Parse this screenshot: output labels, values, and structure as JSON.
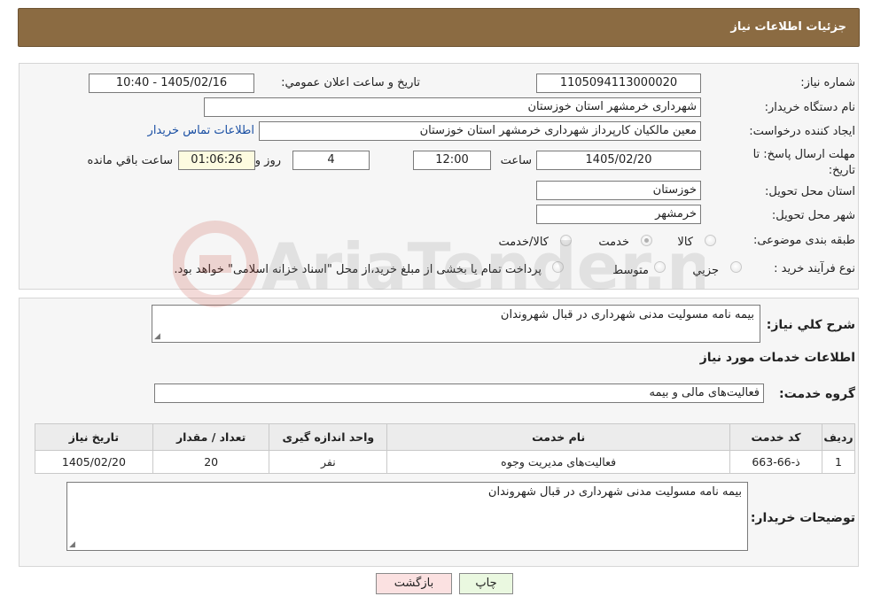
{
  "header": {
    "title": "جزئیات اطلاعات نیاز"
  },
  "form": {
    "need_number_label": "شماره نیاز:",
    "need_number": "1105094113000020",
    "announce_label": "تاریخ و ساعت اعلان عمومي:",
    "announce_value": "1405/02/16 - 10:40",
    "buyer_org_label": "نام دستگاه خریدار:",
    "buyer_org": "شهرداری خرمشهر استان خوزستان",
    "creator_label": "ایجاد کننده درخواست:",
    "creator": "معین مالکیان کارپرداز شهرداری خرمشهر استان خوزستان",
    "contact_link": "اطلاعات تماس خریدار",
    "deadline_label": "مهلت ارسال پاسخ: تا تاریخ:",
    "deadline_date": "1405/02/20",
    "hour_label": "ساعت",
    "deadline_time": "12:00",
    "days": "4",
    "days_label": "روز و",
    "remaining": "01:06:26",
    "remaining_label": "ساعت باقي مانده",
    "province_label": "استان محل تحویل:",
    "province": "خوزستان",
    "city_label": "شهر محل تحویل:",
    "city": "خرمشهر",
    "category_label": "طبقه بندی موضوعی:",
    "category_options": [
      "کالا",
      "خدمت",
      "کالا/خدمت"
    ],
    "process_label": "نوع فرآیند خرید :",
    "process_options": [
      "جزیي",
      "متوسط"
    ],
    "process_note": "پرداخت تمام یا بخشی از مبلغ خرید،از محل \"اسناد خزانه اسلامی\" خواهد بود."
  },
  "details": {
    "description_label": "شرح کلي نیاز:",
    "description": "بیمه نامه مسولیت مدنی شهرداری در قبال شهروندان",
    "services_heading": "اطلاعات خدمات مورد نیاز",
    "service_group_label": "گروه خدمت:",
    "service_group": "فعالیت‌های مالی و بیمه",
    "table": {
      "headers": [
        "ردیف",
        "کد خدمت",
        "نام خدمت",
        "واحد اندازه گیری",
        "تعداد / مقدار",
        "تاریخ نیاز"
      ],
      "rows": [
        [
          "1",
          "ذ-66-663",
          "فعالیت‌های مدیریت وجوه",
          "نفر",
          "20",
          "1405/02/20"
        ]
      ]
    },
    "buyer_notes_label": "توضیحات خریدار:",
    "buyer_notes": "بیمه نامه مسولیت مدنی شهرداری در قبال شهروندان"
  },
  "buttons": {
    "print": "چاپ",
    "back": "بازگشت"
  },
  "watermark": {
    "text": "AriaTender.net"
  },
  "colors": {
    "header": "#8b6b42",
    "link": "#1a4fa3",
    "print_bg": "#eaf8e0",
    "back_bg": "#fbe1e1"
  }
}
